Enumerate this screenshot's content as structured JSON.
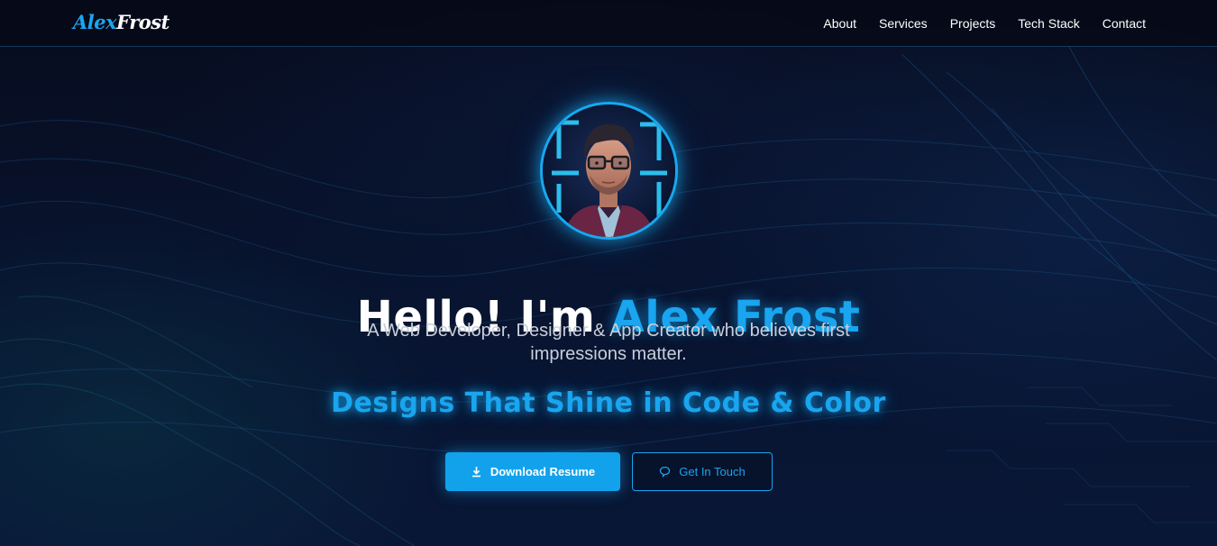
{
  "brand": {
    "first": "Alex",
    "last": "Frost"
  },
  "nav": {
    "items": [
      {
        "label": "About"
      },
      {
        "label": "Services"
      },
      {
        "label": "Projects"
      },
      {
        "label": "Tech Stack"
      },
      {
        "label": "Contact"
      }
    ]
  },
  "hero": {
    "greeting": "Hello! I'm",
    "name": "Alex Frost",
    "subtitle": "A Web Developer, Designer & App Creator who believes first impressions matter.",
    "tagline": "Designs That Shine in Code & Color",
    "primary_button": {
      "label": "Download Resume",
      "icon": "download-icon"
    },
    "secondary_button": {
      "label": "Get In Touch",
      "icon": "chat-bubble-icon"
    }
  },
  "colors": {
    "accent": "#19a5ef",
    "background": "#070c1e",
    "text": "#ffffff",
    "muted_text": "#c9cfda"
  }
}
